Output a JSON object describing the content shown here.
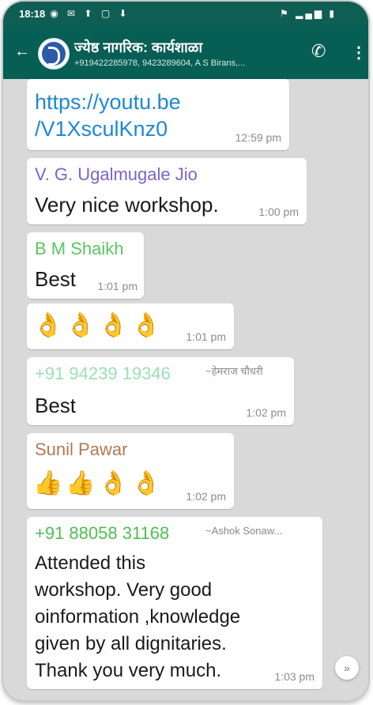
{
  "status_bar": {
    "time": "18:18",
    "left_icons": [
      "whatsapp-icon",
      "message-icon",
      "upload-icon",
      "square-icon",
      "download-icon"
    ],
    "right_icons": [
      "wifi-icon",
      "signal-icon",
      "battery-icon"
    ]
  },
  "header": {
    "title": "ज्येष्ठ नागरिक: कार्यशाळा",
    "subtitle": "+919422285978, 9423289604, A S Birans,..."
  },
  "messages": [
    {
      "type": "link",
      "line1": "https://youtu.be",
      "line2": "/V1XsculKnz0",
      "time": "12:59 pm"
    },
    {
      "sender": "V. G. Ugalmugale Jio",
      "sender_color": "#7b63c9",
      "text": "Very nice workshop.",
      "time": "1:00 pm"
    },
    {
      "sender": "B M Shaikh",
      "sender_color": "#5cc463",
      "text": "Best",
      "time": "1:01 pm"
    },
    {
      "emojis": "👌👌👌👌",
      "time": "1:01 pm"
    },
    {
      "sender": "+91 94239 19346",
      "sender_color": "#9be0b6",
      "alias": "~हेमराज चौधरी",
      "text": "Best",
      "time": "1:02 pm"
    },
    {
      "sender": "Sunil Pawar",
      "sender_color": "#b07a52",
      "emojis": "👍👍👌👌",
      "time": "1:02 pm"
    },
    {
      "sender": "+91 88058 31168",
      "sender_color": "#4fbf53",
      "alias": "~Ashok Sonaw...",
      "lines": [
        "Attended this",
        "workshop. Very good",
        "oinformation ,knowledge",
        "given by all dignitaries.",
        "Thank you very much."
      ],
      "time": "1:03 pm"
    }
  ],
  "scroll_button": "»"
}
